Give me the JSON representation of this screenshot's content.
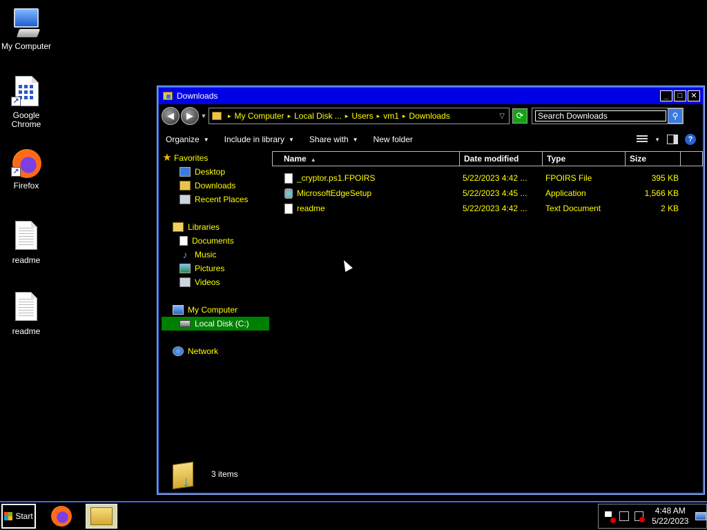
{
  "desktop": {
    "icons": [
      {
        "label": "My Computer",
        "icon": "my-computer-icon"
      },
      {
        "label": "Google Chrome",
        "icon": "chrome-shortcut-icon"
      },
      {
        "label": "Firefox",
        "icon": "firefox-icon"
      },
      {
        "label": "readme",
        "icon": "text-file-icon"
      },
      {
        "label": "readme",
        "icon": "text-file-icon"
      }
    ]
  },
  "window": {
    "title": "Downloads",
    "buttons": {
      "minimize": "_",
      "maximize": "□",
      "close": "✕"
    },
    "nav": {
      "back": "◀",
      "forward": "▶"
    },
    "breadcrumb": [
      "My Computer",
      "Local Disk ...",
      "Users",
      "vm1",
      "Downloads"
    ],
    "search_placeholder": "Search Downloads",
    "commands": {
      "organize": "Organize",
      "include_in_library": "Include in library",
      "share_with": "Share with",
      "new_folder": "New folder"
    },
    "navpane": {
      "favorites": {
        "label": "Favorites",
        "items": [
          "Desktop",
          "Downloads",
          "Recent Places"
        ]
      },
      "libraries": {
        "label": "Libraries",
        "items": [
          "Documents",
          "Music",
          "Pictures",
          "Videos"
        ]
      },
      "computer": {
        "label": "My Computer",
        "items": [
          "Local Disk (C:)"
        ]
      },
      "network": {
        "label": "Network"
      }
    },
    "columns": {
      "name": "Name",
      "date": "Date modified",
      "type": "Type",
      "size": "Size"
    },
    "files": [
      {
        "name": "_cryptor.ps1.FPOIRS",
        "date": "5/22/2023 4:42 ...",
        "type": "FPOIRS File",
        "size": "395 KB",
        "icon": "file-icon"
      },
      {
        "name": "MicrosoftEdgeSetup",
        "date": "5/22/2023 4:45 ...",
        "type": "Application",
        "size": "1,566 KB",
        "icon": "application-icon"
      },
      {
        "name": "readme",
        "date": "5/22/2023 4:42 ...",
        "type": "Text Document",
        "size": "2 KB",
        "icon": "text-file-icon"
      }
    ],
    "status": "3 items"
  },
  "taskbar": {
    "start_label": "Start",
    "apps": [
      "firefox",
      "windows-explorer"
    ],
    "clock": {
      "time": "4:48 AM",
      "date": "5/22/2023"
    }
  },
  "colors": {
    "title_bar": "#0000e6",
    "nav_text": "#ffff00",
    "selected": "#008000",
    "border": "#3a6ee8"
  }
}
